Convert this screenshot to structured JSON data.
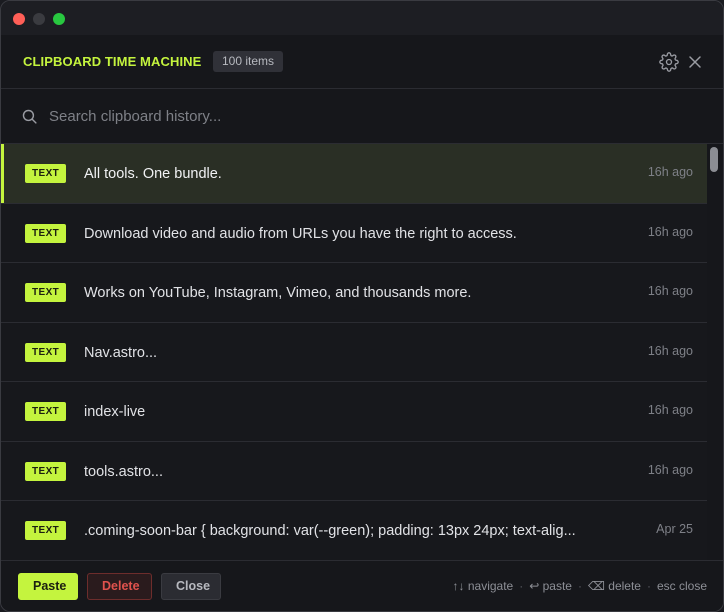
{
  "header": {
    "title": "CLIPBOARD TIME MACHINE",
    "count": "100 items"
  },
  "search": {
    "placeholder": "Search clipboard history..."
  },
  "items": [
    {
      "type": "TEXT",
      "text": "All tools. One bundle.",
      "time": "16h ago",
      "selected": true
    },
    {
      "type": "TEXT",
      "text": "Download video and audio from URLs you have the right to access.",
      "time": "16h ago"
    },
    {
      "type": "TEXT",
      "text": "Works on YouTube, Instagram, Vimeo, and thousands more.",
      "time": "16h ago"
    },
    {
      "type": "TEXT",
      "text": "Nav.astro...",
      "time": "16h ago"
    },
    {
      "type": "TEXT",
      "text": "index-live",
      "time": "16h ago"
    },
    {
      "type": "TEXT",
      "text": "tools.astro...",
      "time": "16h ago"
    },
    {
      "type": "TEXT",
      "text": ".coming-soon-bar {   background: var(--green);   padding: 13px 24px;   text-alig...",
      "time": "Apr 25"
    }
  ],
  "footer": {
    "paste": "Paste",
    "delete": "Delete",
    "close": "Close",
    "hint_navigate": "↑↓ navigate",
    "hint_paste": "↩ paste",
    "hint_delete": "⌫ delete",
    "hint_close": "esc close",
    "separator": "·"
  },
  "colors": {
    "accent": "#c4f43e",
    "danger": "#e0524d",
    "background": "#17181c"
  },
  "icons": {
    "settings": "gear-icon",
    "close": "close-icon",
    "search": "search-icon"
  }
}
